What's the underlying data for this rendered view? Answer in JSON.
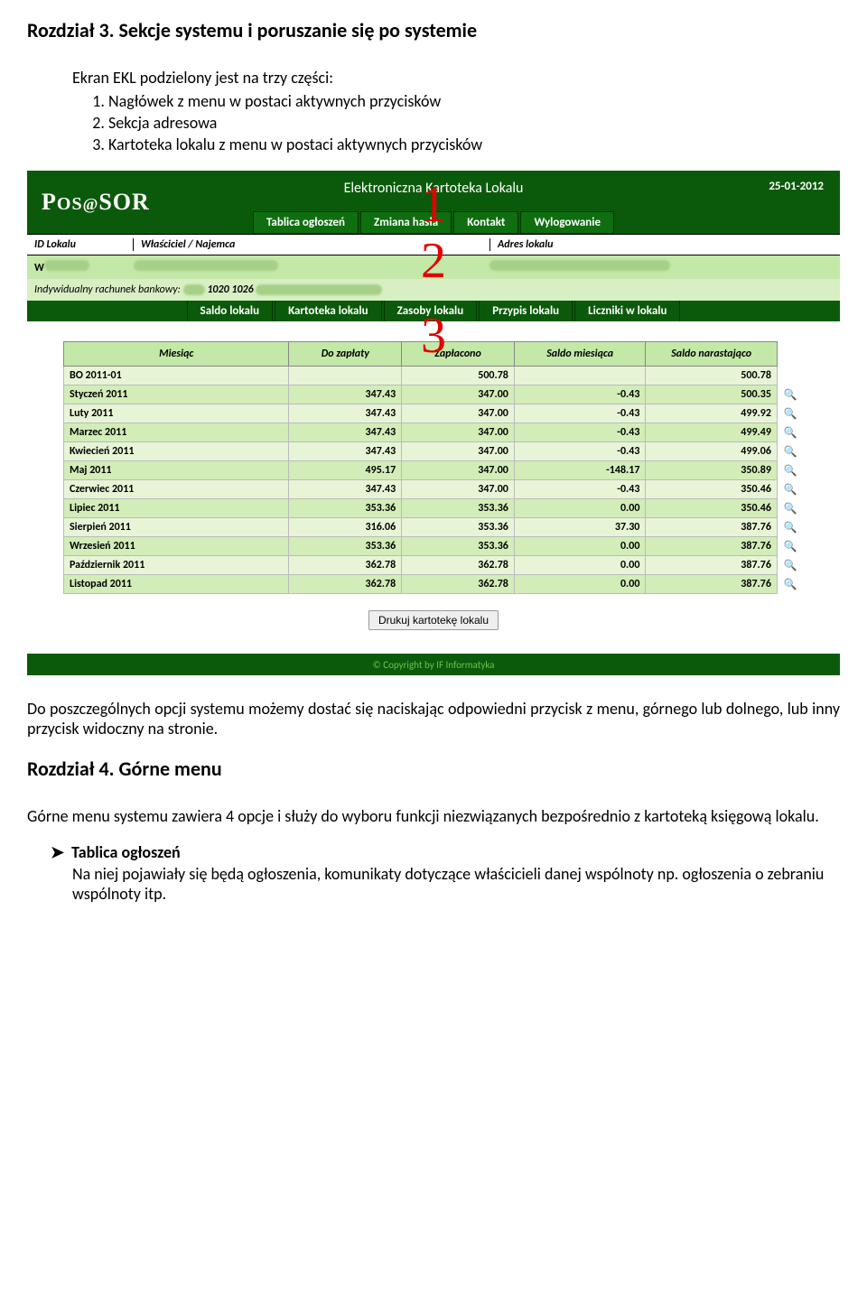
{
  "chapter3_title": "Rozdział 3. Sekcje systemu i poruszanie się po systemie",
  "intro_line": "Ekran EKL podzielony jest na trzy części:",
  "intro_items": [
    "Nagłówek z menu w postaci aktywnych przycisków",
    "Sekcja adresowa",
    "Kartoteka lokalu z menu w postaci aktywnych przycisków"
  ],
  "app": {
    "logo": "POS@SOR",
    "title": "Elektroniczna Kartoteka Lokalu",
    "date": "25-01-2012",
    "top_menu": [
      "Tablica ogłoszeń",
      "Zmiana hasła",
      "Kontakt",
      "Wylogowanie"
    ],
    "id_headers": {
      "c1": "ID Lokalu",
      "c2": "Właściciel / Najemca",
      "c3": "Adres lokalu"
    },
    "id_row": {
      "c1": "W"
    },
    "bank_label": "Indywidualny rachunek bankowy:",
    "bank_value_visible": "1020 1026",
    "section_menu": [
      "Saldo lokalu",
      "Kartoteka lokalu",
      "Zasoby lokalu",
      "Przypis lokalu",
      "Liczniki w lokalu"
    ],
    "table_headers": [
      "Miesiąc",
      "Do zapłaty",
      "Zapłacono",
      "Saldo miesiąca",
      "Saldo narastająco"
    ],
    "rows": [
      {
        "m": "BO 2011-01",
        "dz": "",
        "zp": "500.78",
        "sm": "",
        "sn": "500.78",
        "icon": false
      },
      {
        "m": "Styczeń 2011",
        "dz": "347.43",
        "zp": "347.00",
        "sm": "-0.43",
        "sn": "500.35",
        "icon": true
      },
      {
        "m": "Luty 2011",
        "dz": "347.43",
        "zp": "347.00",
        "sm": "-0.43",
        "sn": "499.92",
        "icon": true
      },
      {
        "m": "Marzec 2011",
        "dz": "347.43",
        "zp": "347.00",
        "sm": "-0.43",
        "sn": "499.49",
        "icon": true
      },
      {
        "m": "Kwiecień 2011",
        "dz": "347.43",
        "zp": "347.00",
        "sm": "-0.43",
        "sn": "499.06",
        "icon": true
      },
      {
        "m": "Maj 2011",
        "dz": "495.17",
        "zp": "347.00",
        "sm": "-148.17",
        "sn": "350.89",
        "icon": true
      },
      {
        "m": "Czerwiec 2011",
        "dz": "347.43",
        "zp": "347.00",
        "sm": "-0.43",
        "sn": "350.46",
        "icon": true
      },
      {
        "m": "Lipiec 2011",
        "dz": "353.36",
        "zp": "353.36",
        "sm": "0.00",
        "sn": "350.46",
        "icon": true
      },
      {
        "m": "Sierpień 2011",
        "dz": "316.06",
        "zp": "353.36",
        "sm": "37.30",
        "sn": "387.76",
        "icon": true
      },
      {
        "m": "Wrzesień 2011",
        "dz": "353.36",
        "zp": "353.36",
        "sm": "0.00",
        "sn": "387.76",
        "icon": true
      },
      {
        "m": "Październik 2011",
        "dz": "362.78",
        "zp": "362.78",
        "sm": "0.00",
        "sn": "387.76",
        "icon": true
      },
      {
        "m": "Listopad 2011",
        "dz": "362.78",
        "zp": "362.78",
        "sm": "0.00",
        "sn": "387.76",
        "icon": true
      }
    ],
    "print_button": "Drukuj kartotekę lokalu",
    "footer": "© Copyright by IF Informatyka"
  },
  "overlay": {
    "n1": "1",
    "n2": "2",
    "n3": "3"
  },
  "para_after_screenshot": "Do poszczególnych opcji systemu możemy dostać się naciskając odpowiedni przycisk z menu, górnego lub dolnego, lub inny przycisk widoczny na stronie.",
  "chapter4_title": "Rozdział 4. Górne menu",
  "chapter4_para": "Górne menu systemu zawiera 4 opcje i służy do wyboru funkcji niezwiązanych bezpośrednio z kartoteką księgową lokalu.",
  "bullet": {
    "head": "Tablica ogłoszeń",
    "body": "Na niej pojawiały się będą ogłoszenia, komunikaty dotyczące właścicieli danej wspólnoty np. ogłoszenia o zebraniu wspólnoty itp."
  }
}
